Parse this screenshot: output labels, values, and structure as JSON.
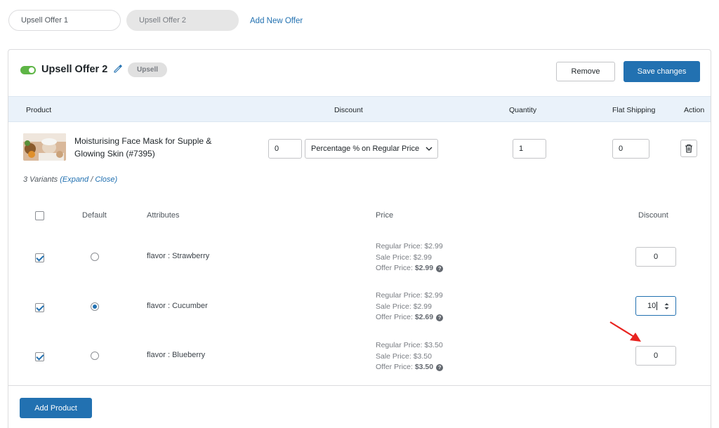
{
  "tabs": [
    "Upsell Offer 1",
    "Upsell Offer 2"
  ],
  "add_offer_label": "Add New Offer",
  "offer": {
    "title": "Upsell Offer 2",
    "badge": "Upsell",
    "enabled": true,
    "remove_label": "Remove",
    "save_label": "Save changes"
  },
  "table_headers": {
    "product": "Product",
    "discount": "Discount",
    "quantity": "Quantity",
    "flat_shipping": "Flat Shipping",
    "action": "Action"
  },
  "product": {
    "name": "Moisturising Face Mask for Supple & Glowing Skin (#7395)",
    "discount_value": "0",
    "discount_type": "Percentage % on Regular Price",
    "quantity": "1",
    "flat_shipping": "0"
  },
  "variants_summary": {
    "count_text": "3 Variants",
    "expand": "Expand",
    "separator": "/",
    "close": "Close",
    "open_paren": "(",
    "close_paren": ")"
  },
  "variant_headers": {
    "default": "Default",
    "attributes": "Attributes",
    "price": "Price",
    "discount": "Discount"
  },
  "variants": [
    {
      "checked": true,
      "default": false,
      "attribute": "flavor : Strawberry",
      "regular_price": "Regular Price: $2.99",
      "sale_price": "Sale Price: $2.99",
      "offer_label": "Offer Price:",
      "offer_price": "$2.99",
      "discount": "0"
    },
    {
      "checked": true,
      "default": true,
      "attribute": "flavor : Cucumber",
      "regular_price": "Regular Price: $2.99",
      "sale_price": "Sale Price: $2.99",
      "offer_label": "Offer Price:",
      "offer_price": "$2.69",
      "discount": "10"
    },
    {
      "checked": true,
      "default": false,
      "attribute": "flavor : Blueberry",
      "regular_price": "Regular Price: $3.50",
      "sale_price": "Sale Price: $3.50",
      "offer_label": "Offer Price:",
      "offer_price": "$3.50",
      "discount": "0"
    }
  ],
  "add_product_label": "Add Product",
  "colors": {
    "primary": "#2271b1",
    "toggle": "#5eb546",
    "arrow": "#e8231f",
    "header_bg": "#eaf2fa"
  },
  "icons": [
    "pencil-icon",
    "chevron-down-icon",
    "trash-icon",
    "help-icon",
    "spinner-icon",
    "arrow-pointer-icon"
  ]
}
